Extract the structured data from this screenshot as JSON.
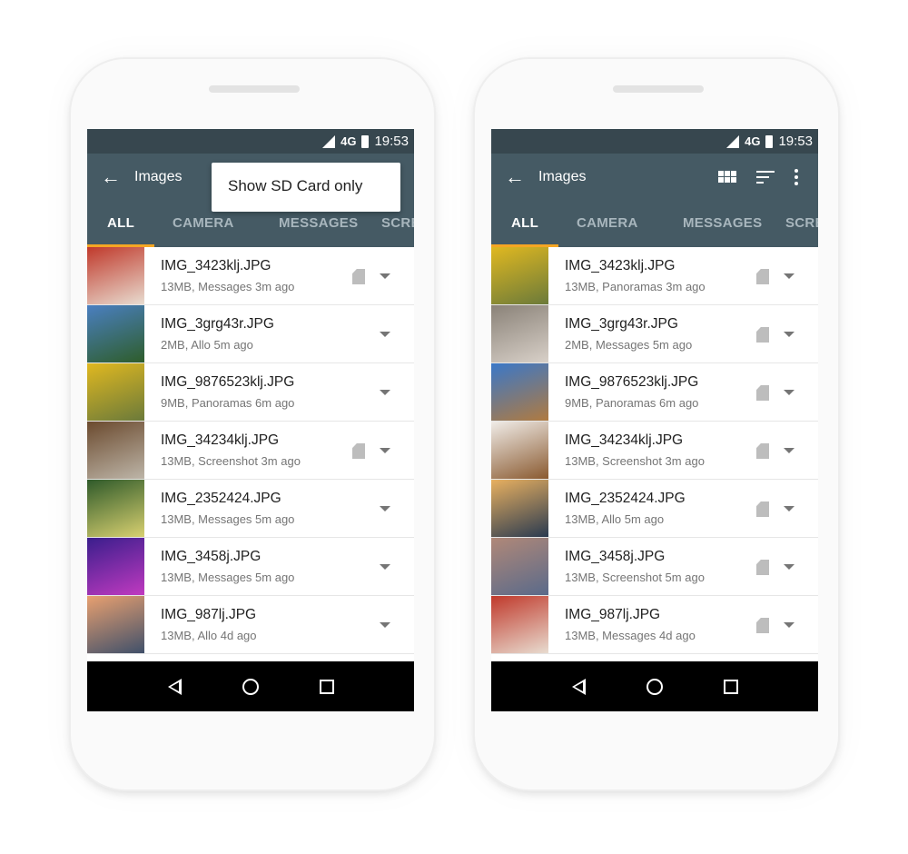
{
  "phones": [
    {
      "status": {
        "network": "4G",
        "time": "19:53"
      },
      "toolbar": {
        "title": "Images",
        "menu_item": "Show SD Card only"
      },
      "tabs": [
        "ALL",
        "CAMERA",
        "MESSAGES",
        "SCREENSHOTS"
      ],
      "files": [
        {
          "name": "IMG_3423klj.JPG",
          "meta": "13MB, Messages  3m ago",
          "sd": true,
          "thumb": [
            "#c0392b",
            "#e8dcd0"
          ]
        },
        {
          "name": "IMG_3grg43r.JPG",
          "meta": "2MB, Allo  5m ago",
          "sd": false,
          "thumb": [
            "#4a7fc1",
            "#2e5d2a"
          ]
        },
        {
          "name": "IMG_9876523klj.JPG",
          "meta": "9MB, Panoramas  6m ago",
          "sd": false,
          "thumb": [
            "#e0b820",
            "#6b7a3a"
          ]
        },
        {
          "name": "IMG_34234klj.JPG",
          "meta": "13MB, Screenshot  3m ago",
          "sd": true,
          "thumb": [
            "#6b4a2e",
            "#bdb5a8"
          ]
        },
        {
          "name": "IMG_2352424.JPG",
          "meta": "13MB, Messages  5m ago",
          "sd": false,
          "thumb": [
            "#2f5a2a",
            "#d8d070"
          ]
        },
        {
          "name": "IMG_3458j.JPG",
          "meta": "13MB, Messages  5m ago",
          "sd": false,
          "thumb": [
            "#3a1e8c",
            "#c03ac0"
          ]
        },
        {
          "name": "IMG_987lj.JPG",
          "meta": "13MB, Allo  4d ago",
          "sd": false,
          "thumb": [
            "#e8a070",
            "#40506a"
          ]
        }
      ]
    },
    {
      "status": {
        "network": "4G",
        "time": "19:53"
      },
      "toolbar": {
        "title": "Images"
      },
      "tabs": [
        "ALL",
        "CAMERA",
        "MESSAGES",
        "SCREENSHOTS"
      ],
      "files": [
        {
          "name": "IMG_3423klj.JPG",
          "meta": "13MB, Panoramas  3m ago",
          "sd": true,
          "thumb": [
            "#e0b820",
            "#6b7a3a"
          ]
        },
        {
          "name": "IMG_3grg43r.JPG",
          "meta": "2MB, Messages  5m ago",
          "sd": true,
          "thumb": [
            "#8a8278",
            "#d8d0c8"
          ]
        },
        {
          "name": "IMG_9876523klj.JPG",
          "meta": "9MB, Panoramas  6m ago",
          "sd": true,
          "thumb": [
            "#3a78c8",
            "#b07a40"
          ]
        },
        {
          "name": "IMG_34234klj.JPG",
          "meta": "13MB, Screenshot  3m ago",
          "sd": true,
          "thumb": [
            "#f0ece8",
            "#8a5a30"
          ]
        },
        {
          "name": "IMG_2352424.JPG",
          "meta": "13MB, Allo  5m ago",
          "sd": true,
          "thumb": [
            "#e8b060",
            "#2a3a50"
          ]
        },
        {
          "name": "IMG_3458j.JPG",
          "meta": "13MB, Screenshot  5m ago",
          "sd": true,
          "thumb": [
            "#b08878",
            "#5a6a8a"
          ]
        },
        {
          "name": "IMG_987lj.JPG",
          "meta": "13MB, Messages  4d ago",
          "sd": true,
          "thumb": [
            "#c0392b",
            "#e8dcd0"
          ]
        }
      ]
    }
  ],
  "colors": {
    "toolbar": "#455a64",
    "status_bar": "#37474f",
    "tab_indicator": "#f5a623"
  }
}
